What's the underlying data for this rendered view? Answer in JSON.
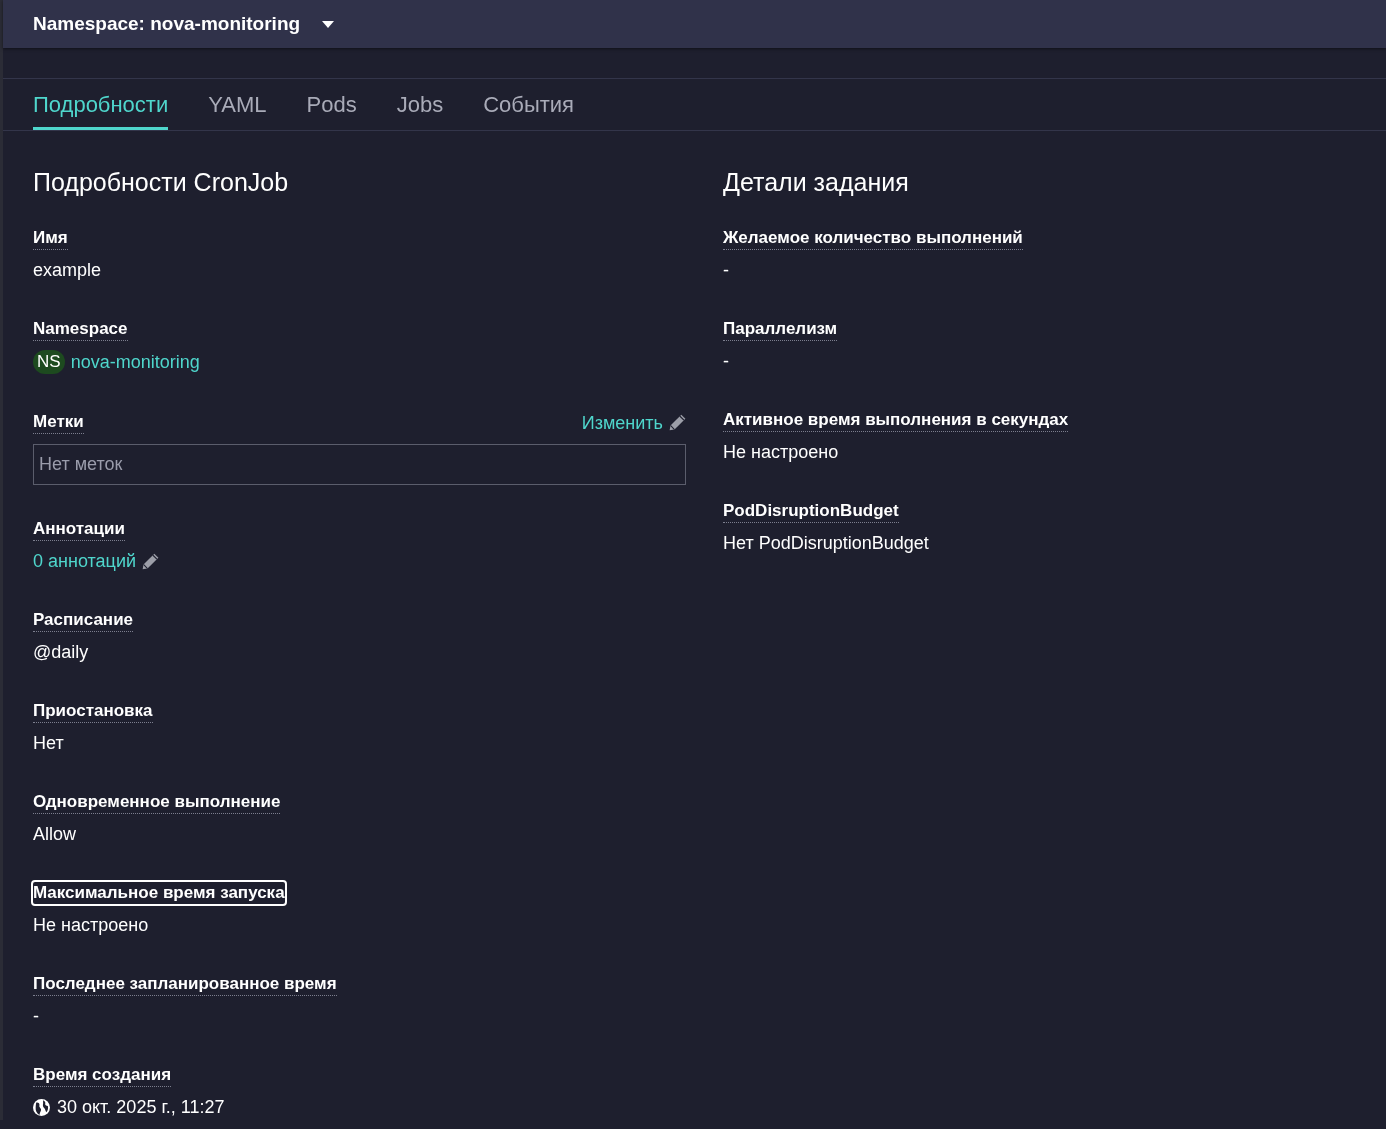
{
  "header": {
    "namespace_selector": "Namespace: nova-monitoring"
  },
  "tabs": [
    {
      "label": "Подробности",
      "selected": true
    },
    {
      "label": "YAML",
      "selected": false
    },
    {
      "label": "Pods",
      "selected": false
    },
    {
      "label": "Jobs",
      "selected": false
    },
    {
      "label": "События",
      "selected": false
    }
  ],
  "left_panel": {
    "title": "Подробности CronJob",
    "fields": [
      {
        "kind": "text",
        "label": "Имя",
        "value": "example",
        "focused": false
      },
      {
        "kind": "namespace",
        "label": "Namespace",
        "badge": "NS",
        "value": "nova-monitoring",
        "focused": false
      },
      {
        "kind": "labels",
        "label": "Метки",
        "action": "Изменить",
        "empty_text": "Нет меток",
        "focused": false
      },
      {
        "kind": "link",
        "label": "Аннотации",
        "value": "0 аннотаций",
        "focused": false
      },
      {
        "kind": "text",
        "label": "Расписание",
        "value": "@daily",
        "focused": false
      },
      {
        "kind": "text",
        "label": "Приостановка",
        "value": "Нет",
        "focused": false
      },
      {
        "kind": "text",
        "label": "Одновременное выполнение",
        "value": "Allow",
        "focused": false
      },
      {
        "kind": "text",
        "label": "Максимальное время запуска",
        "value": "Не настроено",
        "focused": true
      },
      {
        "kind": "text",
        "label": "Последнее запланированное время",
        "value": "-",
        "focused": false
      },
      {
        "kind": "timestamp",
        "label": "Время создания",
        "value": "30 окт. 2025 г., 11:27",
        "focused": false
      }
    ]
  },
  "right_panel": {
    "title": "Детали задания",
    "fields": [
      {
        "kind": "text",
        "label": "Желаемое количество выполнений",
        "value": "-",
        "focused": false
      },
      {
        "kind": "text",
        "label": "Параллелизм",
        "value": "-",
        "focused": false
      },
      {
        "kind": "text",
        "label": "Активное время выполнения в секундах",
        "value": "Не настроено",
        "focused": false
      },
      {
        "kind": "text",
        "label": "PodDisruptionBudget",
        "value": "Нет PodDisruptionBudget",
        "focused": false
      }
    ]
  }
}
